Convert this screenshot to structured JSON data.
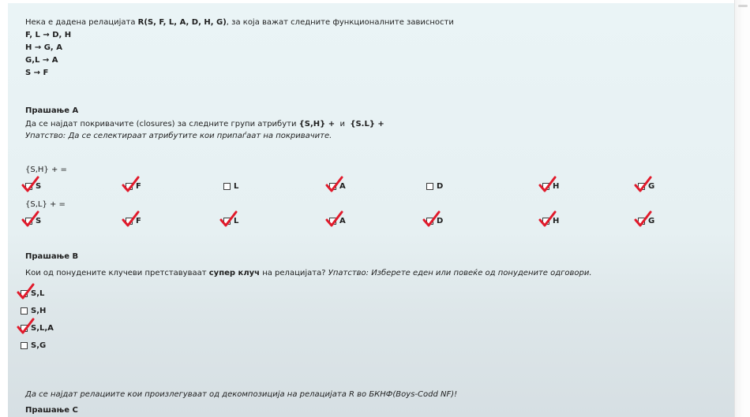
{
  "intro": "Нека е дадена релацијата ",
  "relation": "R(S, F, L, A, D, H, G)",
  "intro_tail": ", за која важат следните функционалните зависности",
  "fds": [
    "F, L → D, H",
    "H → G, A",
    "G,L → A",
    "S → F"
  ],
  "qa": {
    "title": "Прашање А",
    "text_pre": "Да се најдат покривачите (closures) за следните групи атрибути ",
    "g1": "{S,H} +",
    "and": "и",
    "g2": "{S.L} +",
    "hint": "Упатство: Да се селектираат атрибутите кои припаѓаат на покривачите.",
    "set1_label": "{S,H} + =",
    "set2_label": "{S,L} + =",
    "set1": [
      {
        "label": "S",
        "marked": true
      },
      {
        "label": "F",
        "marked": true
      },
      {
        "label": "L",
        "marked": false
      },
      {
        "label": "A",
        "marked": true
      },
      {
        "label": "D",
        "marked": false
      },
      {
        "label": "H",
        "marked": true
      },
      {
        "label": "G",
        "marked": true
      }
    ],
    "set2": [
      {
        "label": "S",
        "marked": true
      },
      {
        "label": "F",
        "marked": true
      },
      {
        "label": "L",
        "marked": true
      },
      {
        "label": "A",
        "marked": true
      },
      {
        "label": "D",
        "marked": true
      },
      {
        "label": "H",
        "marked": true
      },
      {
        "label": "G",
        "marked": true
      }
    ]
  },
  "qb": {
    "title": "Прашање B",
    "text_pre": "Кои од понудените клучеви претставуваат ",
    "text_bold": "супер клуч",
    "text_mid": " на релацијата? ",
    "text_hint": "Упатство: Изберете еден или повеќе од понудените одговори.",
    "options": [
      {
        "label": "S,L",
        "marked": true
      },
      {
        "label": "S,H",
        "marked": false
      },
      {
        "label": "S,L,A",
        "marked": true
      },
      {
        "label": "S,G",
        "marked": false
      }
    ]
  },
  "qc": {
    "intro": "Да се најдат релациите кои произлегуваат од декомпозиција на релацијата R во БКНФ(Boys-Codd NF)!",
    "title": "Прашање C"
  },
  "colors": {
    "check": "#e11a2b",
    "panel": "#e8f2f4"
  }
}
